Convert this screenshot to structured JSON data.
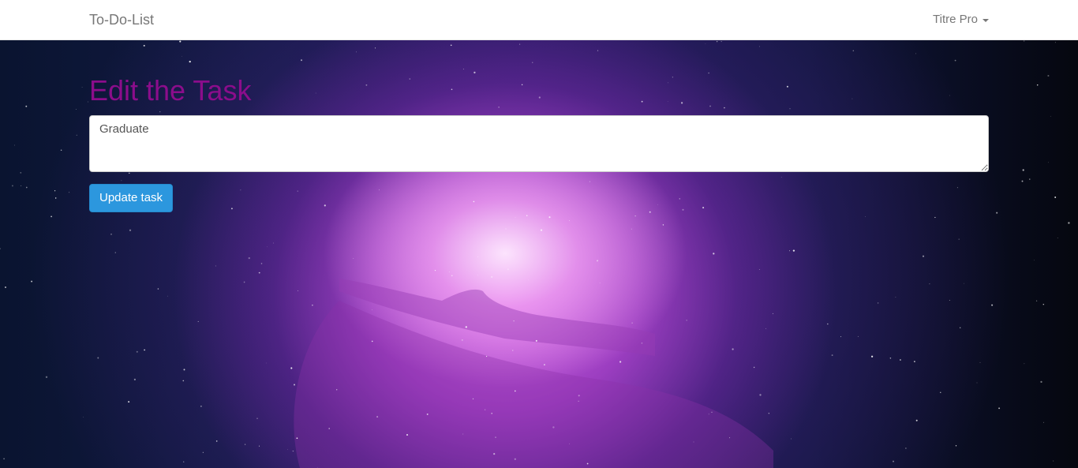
{
  "navbar": {
    "brand": "To-Do-List",
    "user_menu_label": "Titre Pro"
  },
  "main": {
    "title": "Edit the Task",
    "task_value": "Graduate",
    "update_button_label": "Update task"
  },
  "colors": {
    "title": "#8b0d8b",
    "button": "#2c97de",
    "navbar_text": "#777777"
  }
}
